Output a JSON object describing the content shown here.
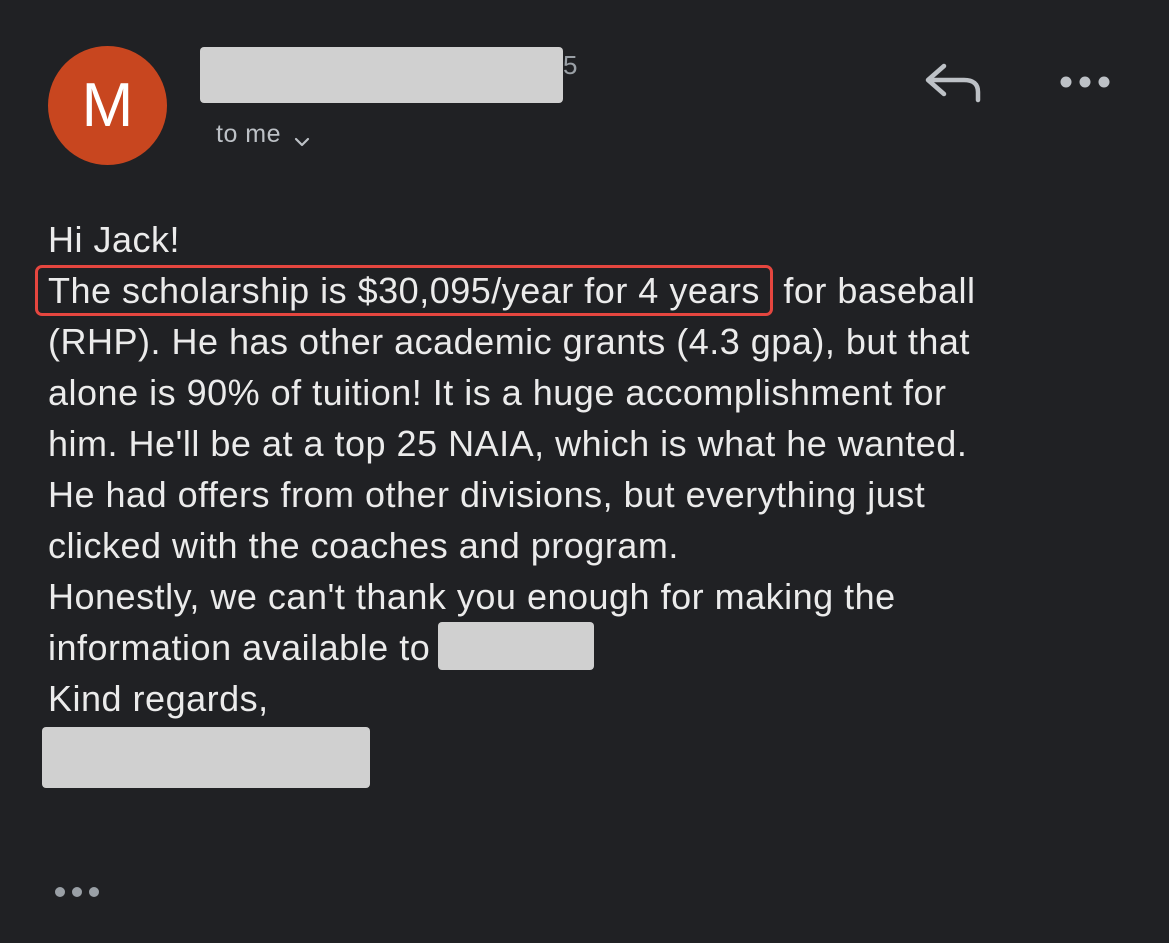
{
  "sender": {
    "avatar_letter": "M",
    "avatar_color": "#c8461f",
    "name_tail": "5",
    "recipient_label": "to me"
  },
  "actions": {
    "reply_icon": "reply-icon",
    "more_icon": "more-vert-icon",
    "expand_icon": "chevron-down-icon"
  },
  "body": {
    "greeting": "Hi Jack!",
    "highlighted": "The scholarship is $30,095/year for 4 years",
    "line1_rest": "for baseball",
    "line2": "(RHP). He has other academic grants (4.3 gpa), but that",
    "line3": "alone is 90% of tuition! It is a huge accomplishment for",
    "line4": "him. He'll be at a top 25 NAIA, which is what he wanted.",
    "line5": "He had offers from other divisions, but everything just",
    "line6": "clicked with the coaches and program.",
    "line7": "Honestly, we can't thank you enough for making the",
    "line8": "information available to",
    "closing": "Kind regards,",
    "highlight_color": "#e5463f"
  },
  "footer": {
    "trimmed_icon": "ellipsis-icon"
  }
}
